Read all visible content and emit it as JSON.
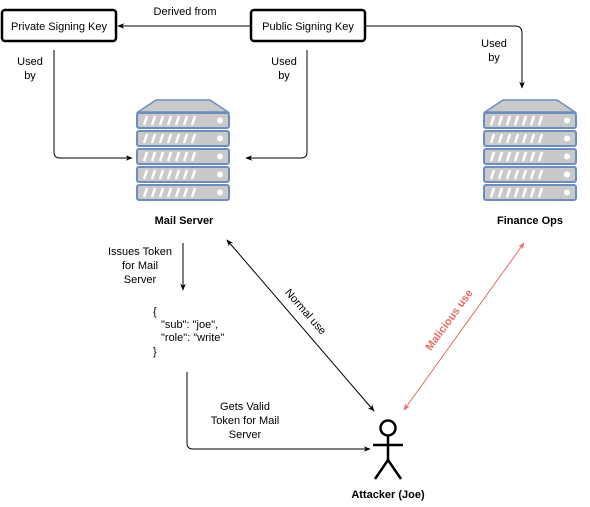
{
  "nodes": {
    "private_key": "Private Signing Key",
    "public_key": "Public Signing Key",
    "mail_server": "Mail Server",
    "finance_ops": "Finance Ops",
    "attacker": "Attacker (Joe)"
  },
  "edges": {
    "derived_from": "Derived from",
    "used_by_private": [
      "Used",
      "by"
    ],
    "used_by_public": [
      "Used",
      "by"
    ],
    "used_by_finance": [
      "Used",
      "by"
    ],
    "issues_token": [
      "Issues Token",
      "for Mail",
      "Server"
    ],
    "gets_valid_token": [
      "Gets Valid",
      "Token for Mail",
      "Server"
    ],
    "normal_use": "Normal use",
    "malicious_use": "Malicious use"
  },
  "token": [
    "{",
    "\"sub\": \"joe\",",
    "\"role\": \"write\"",
    "}"
  ],
  "colors": {
    "malicious": "#ea6b66",
    "server_border": "#6c8ebf",
    "server_fill": "#c9c9c9"
  }
}
